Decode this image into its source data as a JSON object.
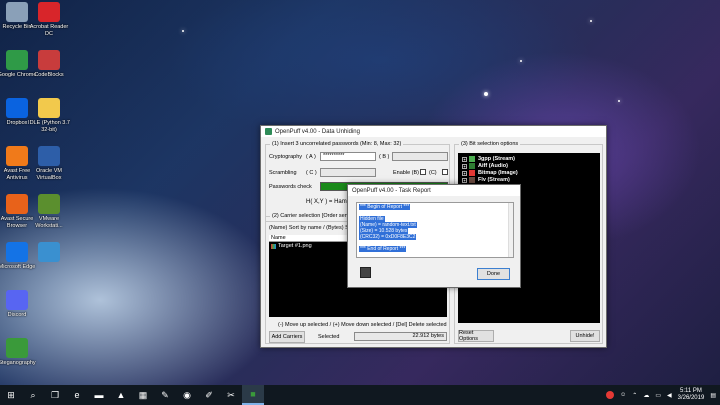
{
  "desktop": {
    "icons": [
      {
        "label": "Recycle Bin",
        "icon": "recycle-bin-icon",
        "color": "#8aa0b8"
      },
      {
        "label": "Acrobat Reader DC",
        "icon": "acrobat-icon",
        "color": "#d8252a"
      },
      {
        "label": "Google Chrome",
        "icon": "chrome-icon",
        "color": "#2f9a47"
      },
      {
        "label": "CodeBlocks",
        "icon": "codeblocks-icon",
        "color": "#c83c3c"
      },
      {
        "label": "Dropbox",
        "icon": "dropbox-icon",
        "color": "#0a63e0"
      },
      {
        "label": "IDLE (Python 3.7 32-bit)",
        "icon": "python-icon",
        "color": "#f2c94c"
      },
      {
        "label": "Avast Free Antivirus",
        "icon": "avast-icon",
        "color": "#f07a1a"
      },
      {
        "label": "Oracle VM VirtualBox",
        "icon": "virtualbox-icon",
        "color": "#2d5ea8"
      },
      {
        "label": "Avast Secure Browser",
        "icon": "avast-browser-icon",
        "color": "#e8621a"
      },
      {
        "label": "VMware Workstati...",
        "icon": "vmware-icon",
        "color": "#5b8f2e"
      },
      {
        "label": "Microsoft Edge",
        "icon": "edge-icon",
        "color": "#1473e6"
      },
      {
        "label": "",
        "icon": "image-file-icon",
        "color": "#3a90d0"
      },
      {
        "label": "Discord",
        "icon": "discord-icon",
        "color": "#5865f2"
      },
      {
        "label": "",
        "icon": "",
        "color": ""
      },
      {
        "label": "Steganography",
        "icon": "steg-folder-icon",
        "color": "#3a9a3a"
      }
    ]
  },
  "main_window": {
    "title": "OpenPuff v4.00 - Data Unhiding",
    "passwords_group": "(1)  Insert 3 uncorrelated passwords (Min: 8, Max: 32)",
    "cryptography_label": "Cryptography",
    "a_label": "( A )",
    "a_value": "**********",
    "b_label": "( B )",
    "scrambling_label": "Scrambling",
    "c_label": "( C )",
    "enable_label": "Enable (B)",
    "enable_c_label": "(C)",
    "passwords_check_label": "Passwords check",
    "hamming_label": "H( X,Y ) = Hamming",
    "carrier_group": "(2)  Carrier selection [Order sensitiv...",
    "sort_label": "(Name) Sort by name / (Bytes) Sort ...",
    "list_header": "Name",
    "carrier_items": [
      "Target #1.png"
    ],
    "move_hint": "(-) Move up selected / (+) Move down selected / [Del] Delete selected",
    "add_carriers_label": "Add Carriers",
    "selected_label": "Selected",
    "selected_bytes": "22.912 bytes",
    "bit_group": "(3)  Bit selection options",
    "bit_options": [
      {
        "label": "3gpp (Stream)",
        "color": "#4caf50"
      },
      {
        "label": "Aiff (Audio)",
        "color": "#2e7d32"
      },
      {
        "label": "Bitmap (Image)",
        "color": "#e53935"
      },
      {
        "label": "Flv (Stream)",
        "color": "#6d4c41"
      }
    ],
    "reset_options_label": "Reset Options",
    "unhide_label": "Unhide!",
    "check_color": "#1a8a1a"
  },
  "report_window": {
    "title": "OpenPuff v4.00 - Task Report",
    "lines": [
      "*** Begin of Report ***",
      "",
      "Hidden file",
      "(Name) = random-text.txt",
      "(Size) = 10.528 bytes",
      "(CRC32) = 0xD0F8E3C2",
      "",
      "*** End of Report ***"
    ],
    "done_label": "Done"
  },
  "taskbar": {
    "apps": [
      "windows-logo-icon",
      "search-icon",
      "task-view-icon",
      "edge-icon",
      "file-explorer-icon",
      "photos-icon",
      "calculator-icon",
      "paint-icon",
      "chrome-icon",
      "notepad-icon",
      "snipping-icon",
      "openpuff-icon"
    ],
    "time": "5:11 PM",
    "date": "3/26/2019"
  }
}
